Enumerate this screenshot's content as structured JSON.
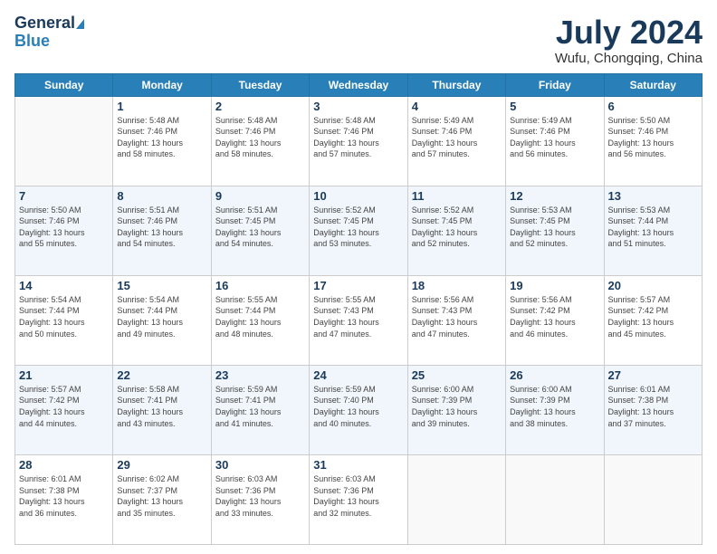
{
  "header": {
    "logo_line1": "General",
    "logo_line2": "Blue",
    "main_title": "July 2024",
    "subtitle": "Wufu, Chongqing, China"
  },
  "days_of_week": [
    "Sunday",
    "Monday",
    "Tuesday",
    "Wednesday",
    "Thursday",
    "Friday",
    "Saturday"
  ],
  "weeks": [
    [
      {
        "day": "",
        "info": ""
      },
      {
        "day": "1",
        "info": "Sunrise: 5:48 AM\nSunset: 7:46 PM\nDaylight: 13 hours\nand 58 minutes."
      },
      {
        "day": "2",
        "info": "Sunrise: 5:48 AM\nSunset: 7:46 PM\nDaylight: 13 hours\nand 58 minutes."
      },
      {
        "day": "3",
        "info": "Sunrise: 5:48 AM\nSunset: 7:46 PM\nDaylight: 13 hours\nand 57 minutes."
      },
      {
        "day": "4",
        "info": "Sunrise: 5:49 AM\nSunset: 7:46 PM\nDaylight: 13 hours\nand 57 minutes."
      },
      {
        "day": "5",
        "info": "Sunrise: 5:49 AM\nSunset: 7:46 PM\nDaylight: 13 hours\nand 56 minutes."
      },
      {
        "day": "6",
        "info": "Sunrise: 5:50 AM\nSunset: 7:46 PM\nDaylight: 13 hours\nand 56 minutes."
      }
    ],
    [
      {
        "day": "7",
        "info": "Sunrise: 5:50 AM\nSunset: 7:46 PM\nDaylight: 13 hours\nand 55 minutes."
      },
      {
        "day": "8",
        "info": "Sunrise: 5:51 AM\nSunset: 7:46 PM\nDaylight: 13 hours\nand 54 minutes."
      },
      {
        "day": "9",
        "info": "Sunrise: 5:51 AM\nSunset: 7:45 PM\nDaylight: 13 hours\nand 54 minutes."
      },
      {
        "day": "10",
        "info": "Sunrise: 5:52 AM\nSunset: 7:45 PM\nDaylight: 13 hours\nand 53 minutes."
      },
      {
        "day": "11",
        "info": "Sunrise: 5:52 AM\nSunset: 7:45 PM\nDaylight: 13 hours\nand 52 minutes."
      },
      {
        "day": "12",
        "info": "Sunrise: 5:53 AM\nSunset: 7:45 PM\nDaylight: 13 hours\nand 52 minutes."
      },
      {
        "day": "13",
        "info": "Sunrise: 5:53 AM\nSunset: 7:44 PM\nDaylight: 13 hours\nand 51 minutes."
      }
    ],
    [
      {
        "day": "14",
        "info": "Sunrise: 5:54 AM\nSunset: 7:44 PM\nDaylight: 13 hours\nand 50 minutes."
      },
      {
        "day": "15",
        "info": "Sunrise: 5:54 AM\nSunset: 7:44 PM\nDaylight: 13 hours\nand 49 minutes."
      },
      {
        "day": "16",
        "info": "Sunrise: 5:55 AM\nSunset: 7:44 PM\nDaylight: 13 hours\nand 48 minutes."
      },
      {
        "day": "17",
        "info": "Sunrise: 5:55 AM\nSunset: 7:43 PM\nDaylight: 13 hours\nand 47 minutes."
      },
      {
        "day": "18",
        "info": "Sunrise: 5:56 AM\nSunset: 7:43 PM\nDaylight: 13 hours\nand 47 minutes."
      },
      {
        "day": "19",
        "info": "Sunrise: 5:56 AM\nSunset: 7:42 PM\nDaylight: 13 hours\nand 46 minutes."
      },
      {
        "day": "20",
        "info": "Sunrise: 5:57 AM\nSunset: 7:42 PM\nDaylight: 13 hours\nand 45 minutes."
      }
    ],
    [
      {
        "day": "21",
        "info": "Sunrise: 5:57 AM\nSunset: 7:42 PM\nDaylight: 13 hours\nand 44 minutes."
      },
      {
        "day": "22",
        "info": "Sunrise: 5:58 AM\nSunset: 7:41 PM\nDaylight: 13 hours\nand 43 minutes."
      },
      {
        "day": "23",
        "info": "Sunrise: 5:59 AM\nSunset: 7:41 PM\nDaylight: 13 hours\nand 41 minutes."
      },
      {
        "day": "24",
        "info": "Sunrise: 5:59 AM\nSunset: 7:40 PM\nDaylight: 13 hours\nand 40 minutes."
      },
      {
        "day": "25",
        "info": "Sunrise: 6:00 AM\nSunset: 7:39 PM\nDaylight: 13 hours\nand 39 minutes."
      },
      {
        "day": "26",
        "info": "Sunrise: 6:00 AM\nSunset: 7:39 PM\nDaylight: 13 hours\nand 38 minutes."
      },
      {
        "day": "27",
        "info": "Sunrise: 6:01 AM\nSunset: 7:38 PM\nDaylight: 13 hours\nand 37 minutes."
      }
    ],
    [
      {
        "day": "28",
        "info": "Sunrise: 6:01 AM\nSunset: 7:38 PM\nDaylight: 13 hours\nand 36 minutes."
      },
      {
        "day": "29",
        "info": "Sunrise: 6:02 AM\nSunset: 7:37 PM\nDaylight: 13 hours\nand 35 minutes."
      },
      {
        "day": "30",
        "info": "Sunrise: 6:03 AM\nSunset: 7:36 PM\nDaylight: 13 hours\nand 33 minutes."
      },
      {
        "day": "31",
        "info": "Sunrise: 6:03 AM\nSunset: 7:36 PM\nDaylight: 13 hours\nand 32 minutes."
      },
      {
        "day": "",
        "info": ""
      },
      {
        "day": "",
        "info": ""
      },
      {
        "day": "",
        "info": ""
      }
    ]
  ]
}
